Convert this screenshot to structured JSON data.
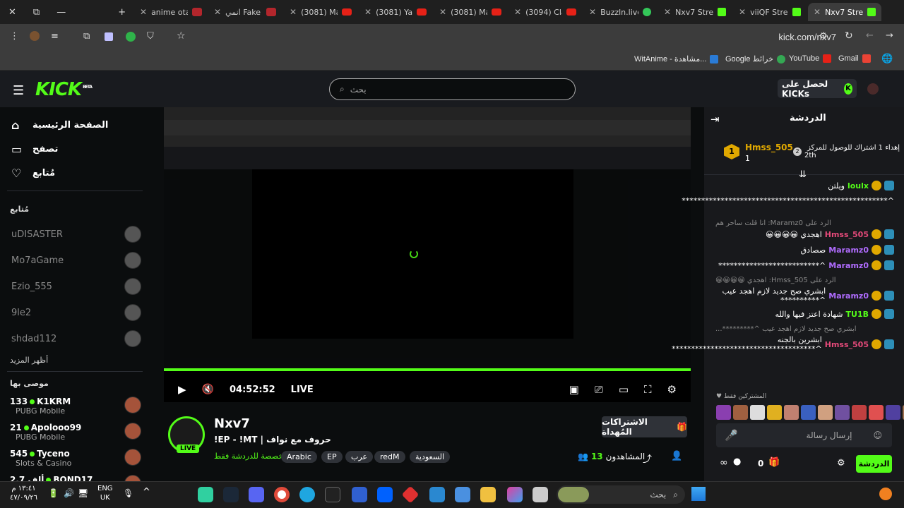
{
  "window_controls": {
    "close": "✕",
    "restore": "⧉",
    "minimize": "—",
    "new_tab": "+"
  },
  "tabs": [
    {
      "label": "anime otaku",
      "icon": "top"
    },
    {
      "label": "انمي Fake",
      "icon": "top"
    },
    {
      "label": "(3081) Mai",
      "icon": "youtube"
    },
    {
      "label": "(3081) Ya",
      "icon": "youtube"
    },
    {
      "label": "(3081) Mai",
      "icon": "youtube"
    },
    {
      "label": "(3094) Clap",
      "icon": "youtube"
    },
    {
      "label": "Buzzln.live",
      "icon": "buzz"
    },
    {
      "label": "Nxv7 Strea",
      "icon": "kick"
    },
    {
      "label": "viiQF Strea",
      "icon": "kick"
    },
    {
      "label": "Nxv7 Strea",
      "icon": "kick",
      "active": true
    }
  ],
  "address": {
    "url": "kick.com/nxv7"
  },
  "bookmarks": [
    {
      "label": "WitAnime - مشاهدة...",
      "color": "#2a7bd6"
    },
    {
      "label": "Google خرائط",
      "color": "#34a853"
    },
    {
      "label": "YouTube",
      "color": "#e62117"
    },
    {
      "label": "Gmail",
      "color": "#ea4335"
    }
  ],
  "kick": {
    "logo": "KICK",
    "beta": "BETA",
    "search_placeholder": "بحث",
    "get_kicks": "لحصل على KICKs"
  },
  "sidebar": {
    "nav": [
      {
        "label": "الصفحة الرئيسية",
        "icon": "home-icon"
      },
      {
        "label": "تصفح",
        "icon": "browse-icon"
      },
      {
        "label": "مُتابع",
        "icon": "heart-icon"
      }
    ],
    "following_heading": "مُتابع",
    "offline": [
      "uDISASTER",
      "Mo7aGame",
      "Ezio_555",
      "9le2",
      "shdad112"
    ],
    "show_more": "أظهر المزيد",
    "recommended_heading": "موصى بها",
    "recommended": [
      {
        "viewers": "133",
        "name": "K1KRM",
        "category": "PUBG Mobile"
      },
      {
        "viewers": "21",
        "name": "Apolooo99",
        "category": "PUBG Mobile"
      },
      {
        "viewers": "545",
        "name": "Tyceno",
        "category": "Slots & Casino"
      },
      {
        "viewers": "2.7 ألف",
        "name": "BOND17",
        "category": ""
      }
    ]
  },
  "player": {
    "time": "04:52:52",
    "live_label": "LIVE",
    "progress": 1.0
  },
  "stream": {
    "channel": "Nxv7",
    "title": "!EP - !MT | حروف مع نواف",
    "sub_only": "مخصصة للدردشة فقط",
    "tags": [
      "Arabic",
      "EP",
      "عرب",
      "redM",
      "السعودية"
    ],
    "gift_button": "الاشتراكات المُهداة",
    "viewers_label": "المشاهدون",
    "viewers_count": "13",
    "live_badge": "LIVE"
  },
  "chat": {
    "title": "الدردشة",
    "pinned": {
      "user": "Hmss_505",
      "count": "1",
      "text": "إهداء 1 اشتراك للوصول للمركز",
      "rank": "2th",
      "rank_num": "2"
    },
    "messages": [
      {
        "user": "loulx",
        "text": "ويلتن",
        "cls": "u3"
      },
      {
        "user": "",
        "text": "^*****************************************************",
        "cls": ""
      },
      {
        "reply": "الرد على Maramz0: انا قلت ساحر هم",
        "user": "Hmss_505",
        "text": "اهجدي 😀😀😀😀",
        "cls": "u1"
      },
      {
        "user": "Maramz0",
        "text": "صصادق",
        "cls": "u2"
      },
      {
        "user": "Maramz0",
        "text": "^**************************",
        "cls": "u2"
      },
      {
        "reply": "الرد على Hmss_505: اهجدي 😀😀😀😀",
        "user": "Maramz0",
        "text": "ابشري صح جديد لازم اهجد عيب ^**********",
        "cls": "u2"
      },
      {
        "user": "TU1B",
        "text": "شهادة اعتز فيها والله",
        "cls": "u3"
      },
      {
        "reply": "ابشري صح جديد لازم اهجد عيب ^*********...",
        "user": "Hmss_505",
        "text": "ابشرين بالجنه ^*************************************",
        "cls": "u1"
      }
    ],
    "subs_only_label": "المشتركين فقط",
    "input_placeholder": "إرسال رسالة",
    "points": "0",
    "send_label": "الدردشة"
  },
  "taskbar": {
    "search_placeholder": "بحث",
    "lang": "ENG",
    "region": "UK",
    "time": "١٣:٤١ م",
    "date": "٤٧/٠٩/٢٦"
  }
}
